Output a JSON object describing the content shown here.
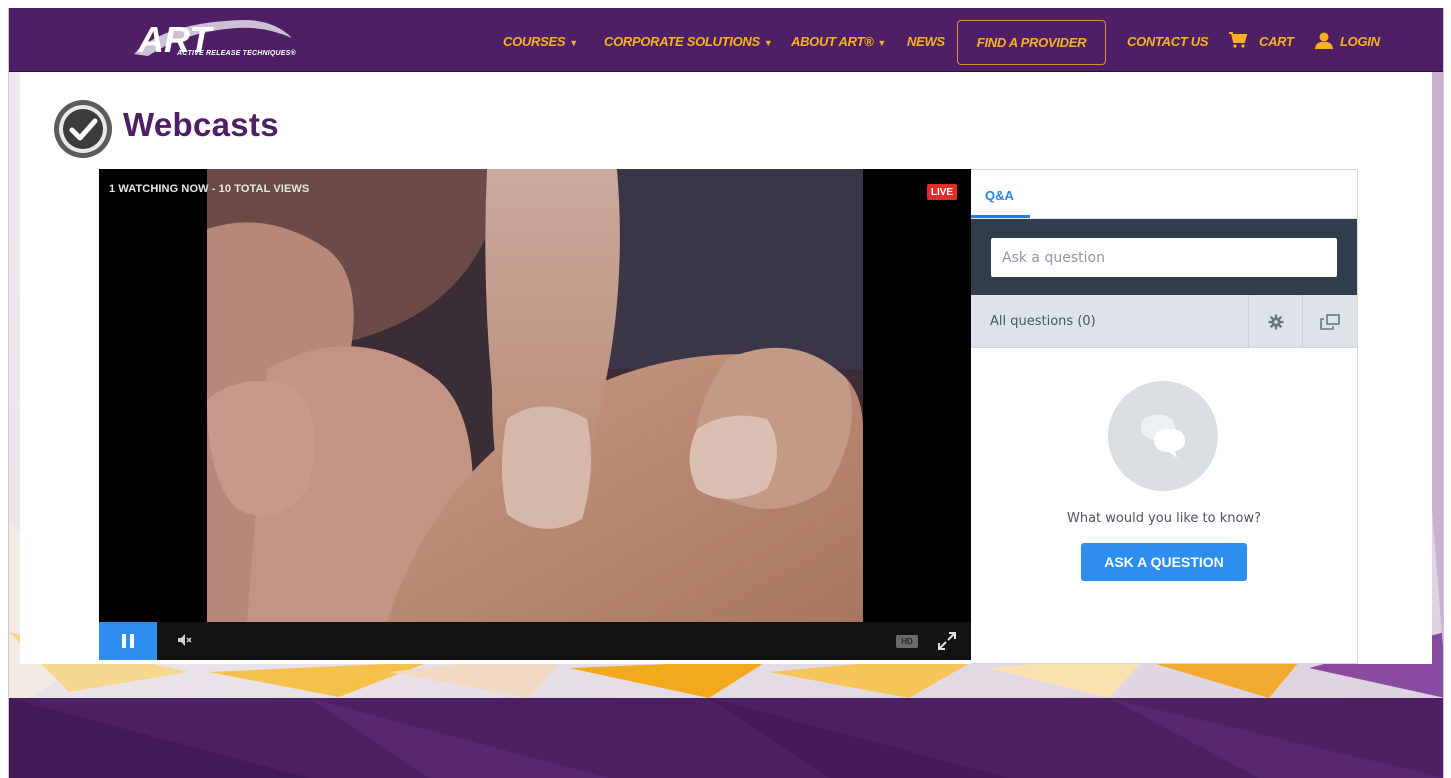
{
  "brand": {
    "logo_text": "ART",
    "tagline": "ACTIVE RELEASE TECHNIQUES®"
  },
  "nav": {
    "items": [
      {
        "label": "COURSES",
        "has_dropdown": true
      },
      {
        "label": "CORPORATE SOLUTIONS",
        "has_dropdown": true
      },
      {
        "label": "ABOUT ART®",
        "has_dropdown": true
      },
      {
        "label": "NEWS",
        "has_dropdown": false
      }
    ],
    "find_provider": "FIND A PROVIDER",
    "contact": "CONTACT US",
    "cart": "CART",
    "login": "LOGIN",
    "cart_icon": "cart-icon",
    "login_icon": "user-icon"
  },
  "page": {
    "title": "Webcasts",
    "title_icon": "check-circle-icon"
  },
  "player": {
    "viewers": "1 WATCHING NOW - 10 TOTAL VIEWS",
    "live_label": "LIVE",
    "hd_label": "HD",
    "state": "playing",
    "muted": true
  },
  "qa": {
    "tab": "Q&A",
    "input_placeholder": "Ask a question",
    "filter_label": "All questions (0)",
    "empty_prompt": "What would you like to know?",
    "ask_button": "ASK A QUESTION"
  },
  "colors": {
    "nav_bg": "#4f1f66",
    "nav_text": "#f6b21b",
    "accent_blue": "#2d8ef0",
    "live_red": "#e22b2b",
    "title_purple": "#4f1f66"
  }
}
